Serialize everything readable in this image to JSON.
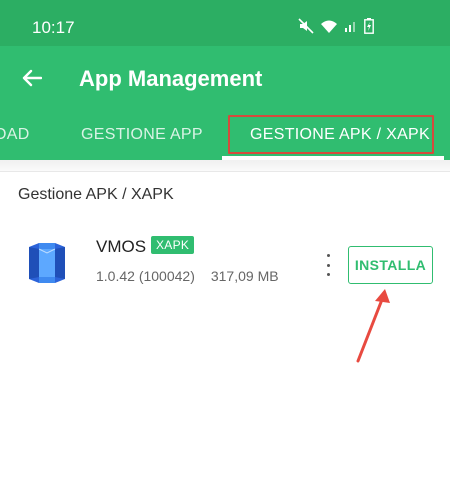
{
  "status_bar": {
    "time": "10:17",
    "icons": [
      "mute-icon",
      "wifi-icon",
      "signal-icon",
      "battery-charging-icon"
    ]
  },
  "app_bar": {
    "title": "App Management",
    "back_icon": "arrow-left-icon"
  },
  "tabs": [
    {
      "label": "OAD",
      "selected": false
    },
    {
      "label": "GESTIONE APP",
      "selected": false
    },
    {
      "label": "GESTIONE APK / XAPK",
      "selected": true
    }
  ],
  "section": {
    "title": "Gestione APK / XAPK"
  },
  "app_item": {
    "name": "VMOS",
    "badge": "XAPK",
    "version": "1.0.42 (100042)",
    "size": "317,09 MB",
    "more_icon": "more-vert-icon",
    "install_label": "INSTALLA"
  },
  "colors": {
    "primary": "#30bd70",
    "status_bar": "#2cae63",
    "highlight_box": "#d64a3d",
    "annotation_arrow": "#e84a40"
  }
}
